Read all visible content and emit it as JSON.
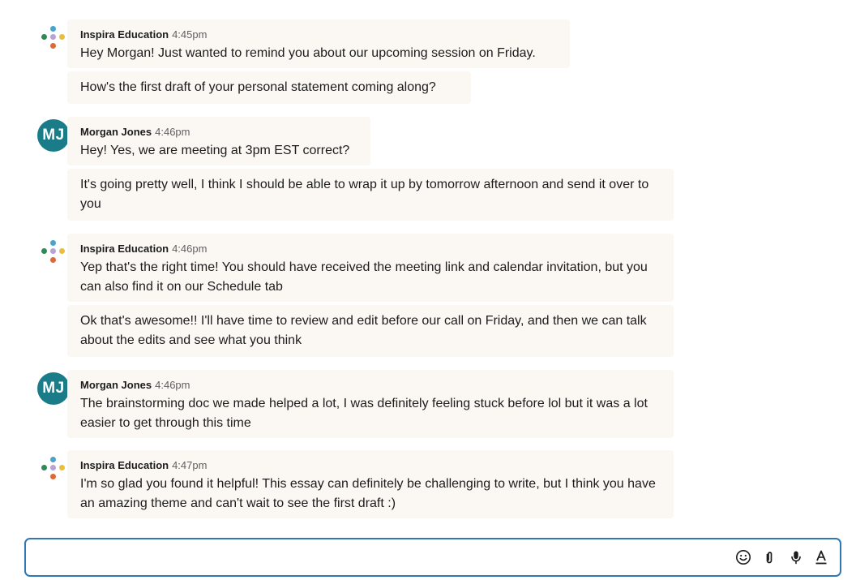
{
  "messages": [
    {
      "sender": "Inspira Education",
      "time": "4:45pm",
      "avatar": "inspira-logo",
      "lines": [
        "Hey Morgan! Just wanted to remind you about our upcoming session on Friday.",
        "How's the first draft of your personal statement coming along?"
      ]
    },
    {
      "sender": "Morgan Jones",
      "time": "4:46pm",
      "avatar_initials": "MJ",
      "lines": [
        "Hey! Yes, we are meeting at 3pm EST correct?",
        "It's going pretty well, I think I should be able to wrap it up by tomorrow afternoon and send it over to you"
      ]
    },
    {
      "sender": "Inspira Education",
      "time": "4:46pm",
      "avatar": "inspira-logo",
      "lines": [
        "Yep that's the right time! You should have received the meeting link and calendar invitation, but you can also find it on our Schedule tab",
        "Ok that's awesome!! I'll have time to review and edit before our call on Friday, and then we can talk about the edits and see what you think"
      ]
    },
    {
      "sender": "Morgan Jones",
      "time": "4:46pm",
      "avatar_initials": "MJ",
      "lines": [
        "The brainstorming doc we made helped a lot, I was definitely feeling stuck before lol but it was a lot easier to get through this time"
      ]
    },
    {
      "sender": "Inspira Education",
      "time": "4:47pm",
      "avatar": "inspira-logo",
      "lines": [
        "I'm so glad you found it helpful! This essay can definitely be challenging to write, but I think you have an amazing theme and can't wait to see the first draft :)"
      ]
    }
  ],
  "composer": {
    "value": "",
    "placeholder": "",
    "tools": [
      "emoji-icon",
      "attachment-icon",
      "microphone-icon",
      "text-format-icon"
    ]
  },
  "colors": {
    "avatar_bg": "#1a7c89",
    "bubble_bg": "#fbf8f3",
    "composer_border": "#2f78b4",
    "logo_green": "#2e8b57",
    "logo_blue": "#4aa3c9",
    "logo_yellow": "#e6c03c",
    "logo_purple": "#b6a4d3",
    "logo_orange": "#dd6a36"
  }
}
